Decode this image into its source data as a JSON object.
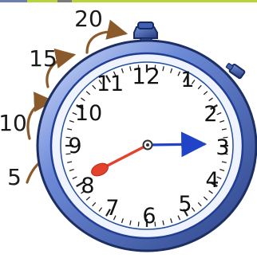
{
  "illustration": {
    "subject": "stopwatch",
    "annotations": [
      "5",
      "10",
      "15",
      "20"
    ],
    "dial_numbers": [
      "12",
      "1",
      "2",
      "3",
      "4",
      "5",
      "6",
      "7",
      "8",
      "9",
      "10",
      "11"
    ],
    "colors": {
      "accent_top_bar": "#b7d43b",
      "case": "#5d7ac8",
      "case_dark": "#283f82",
      "hand_blue": "#2143c8",
      "hand_red": "#e3422d",
      "arrow": "#8b5a2b"
    },
    "hands": {
      "blue": {
        "points_to": "3"
      },
      "red": {
        "points_to": "8"
      }
    }
  }
}
